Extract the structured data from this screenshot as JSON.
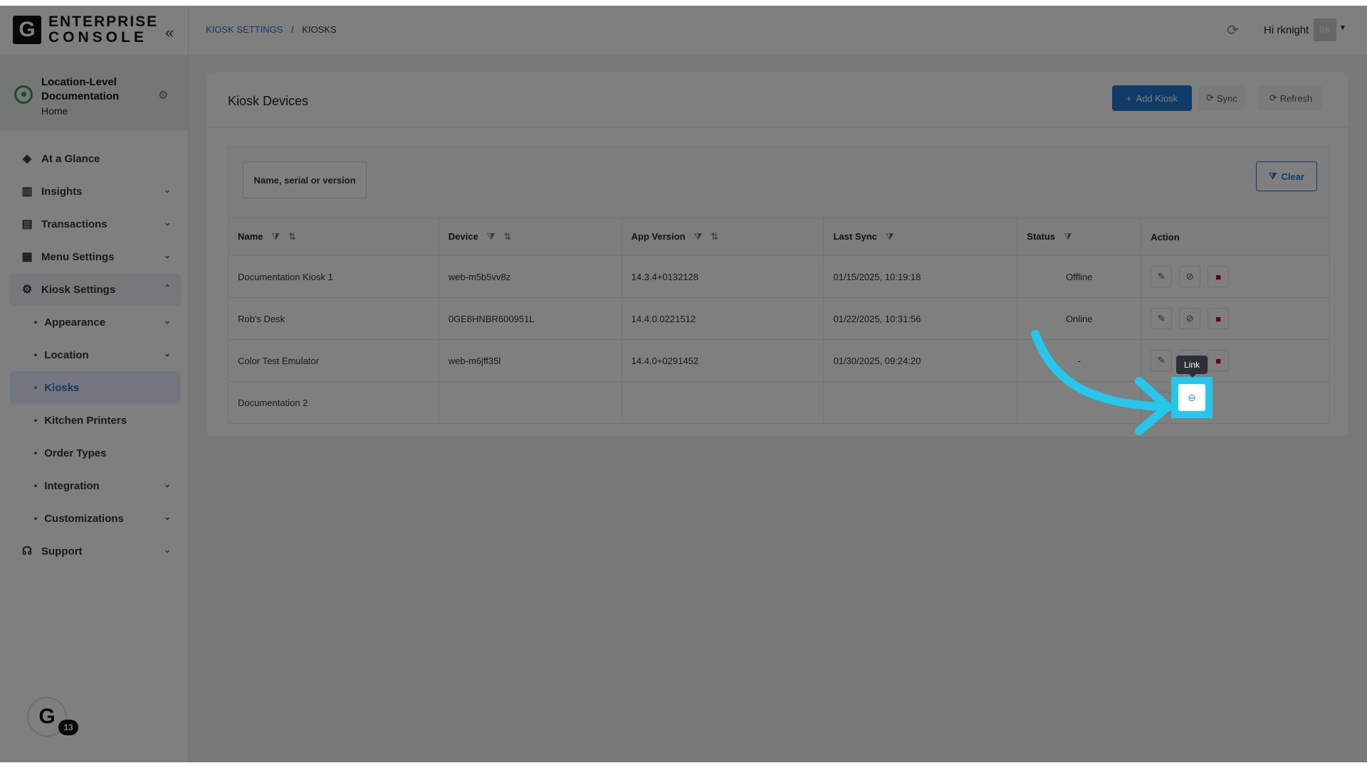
{
  "brand": {
    "logo": "G",
    "line1": "ENTERPRISE",
    "line2": "CONSOLE"
  },
  "location": {
    "title": "Location-Level Documentation",
    "subtitle": "Home"
  },
  "nav": {
    "at_a_glance": "At a Glance",
    "insights": "Insights",
    "transactions": "Transactions",
    "menu_settings": "Menu Settings",
    "kiosk_settings": "Kiosk Settings",
    "sub": {
      "appearance": "Appearance",
      "location": "Location",
      "kiosks": "Kiosks",
      "kitchen_printers": "Kitchen Printers",
      "order_types": "Order Types",
      "integration": "Integration",
      "customizations": "Customizations"
    },
    "support": "Support"
  },
  "floating_avatar": {
    "letter": "G",
    "count": "13"
  },
  "topbar": {
    "breadcrumb": [
      "KIOSK SETTINGS",
      "KIOSKS"
    ],
    "greeting": "Hi rknight",
    "avatar_initials": "RK"
  },
  "card": {
    "title": "Kiosk Devices",
    "add_button": "Add Kiosk",
    "sync_button": "Sync",
    "refresh_button": "Refresh"
  },
  "filter": {
    "search_placeholder": "Name, serial or version",
    "clear_button": "Clear"
  },
  "table": {
    "headers": [
      "Name",
      "Device",
      "App Version",
      "Last Sync",
      "Status",
      "Action"
    ],
    "rows": [
      {
        "name": "Documentation Kiosk 1",
        "device": "web-m5b5vv8z",
        "version": "14.3.4+0132128",
        "last_sync": "01/15/2025, 10:19:18",
        "status": "Offline"
      },
      {
        "name": "Rob's Desk",
        "device": "0GE8HNBR600951L",
        "version": "14.4.0.0221512",
        "last_sync": "01/22/2025, 10:31:56",
        "status": "Online"
      },
      {
        "name": "Color Test Emulator",
        "device": "web-m6jff35l",
        "version": "14.4.0+0291452",
        "last_sync": "01/30/2025, 09:24:20",
        "status": "-"
      },
      {
        "name": "Documentation 2",
        "device": "",
        "version": "",
        "last_sync": "",
        "status": ""
      }
    ]
  },
  "tooltip": "Link",
  "highlight_color": "#25c7ec",
  "accent_color": "#1f78d1",
  "icons": {
    "edit": "pencil-icon",
    "unlink": "unlink-icon",
    "link": "link-icon",
    "delete": "trash-icon"
  }
}
